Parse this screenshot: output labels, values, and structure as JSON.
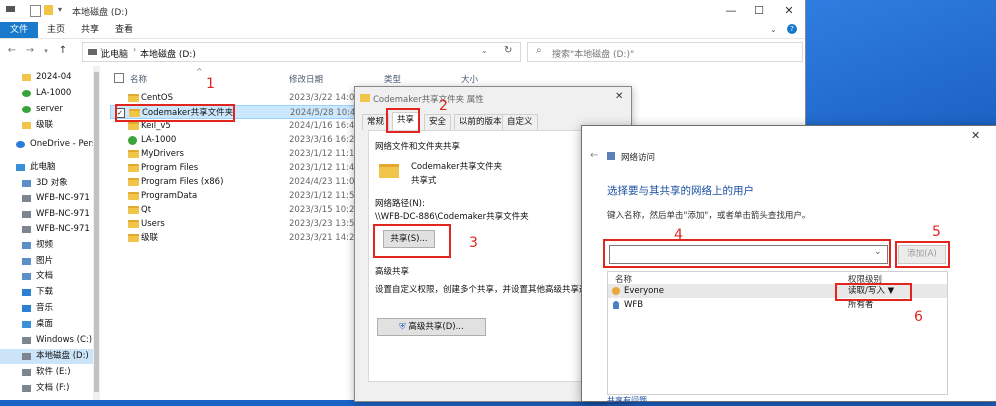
{
  "window": {
    "title": "本地磁盘 (D:)",
    "min": "—",
    "max": "☐",
    "close": "✕",
    "help": "?"
  },
  "ribbon": {
    "tabs": [
      "文件",
      "主页",
      "共享",
      "查看"
    ]
  },
  "address": {
    "path": [
      "此电脑",
      "本地磁盘 (D:)"
    ],
    "search_placeholder": "搜索\"本地磁盘 (D:)\""
  },
  "nav": {
    "items": [
      {
        "label": "2024-04",
        "icon": "folder-icon"
      },
      {
        "label": "LA-1000",
        "icon": "folder-check-icon"
      },
      {
        "label": "server",
        "icon": "folder-check-icon"
      },
      {
        "label": "级联",
        "icon": "folder-icon"
      },
      {
        "label": "OneDrive - Perso",
        "icon": "cloud-icon"
      },
      {
        "label": "此电脑",
        "icon": "computer-icon"
      },
      {
        "label": "3D 对象",
        "icon": "3d-objects-icon"
      },
      {
        "label": "WFB-NC-971 上",
        "icon": "network-drive-icon"
      },
      {
        "label": "WFB-NC-971 上",
        "icon": "network-drive-icon"
      },
      {
        "label": "WFB-NC-971 上",
        "icon": "network-drive-icon"
      },
      {
        "label": "视频",
        "icon": "video-icon"
      },
      {
        "label": "图片",
        "icon": "pictures-icon"
      },
      {
        "label": "文档",
        "icon": "documents-icon"
      },
      {
        "label": "下载",
        "icon": "download-icon"
      },
      {
        "label": "音乐",
        "icon": "music-icon"
      },
      {
        "label": "桌面",
        "icon": "desktop-icon"
      },
      {
        "label": "Windows (C:)",
        "icon": "drive-icon"
      },
      {
        "label": "本地磁盘 (D:)",
        "icon": "drive-icon",
        "selected": true
      },
      {
        "label": "软件 (E:)",
        "icon": "drive-icon"
      },
      {
        "label": "文档 (F:)",
        "icon": "drive-icon"
      }
    ]
  },
  "files": {
    "headers": {
      "name": "名称",
      "date": "修改日期",
      "type": "类型",
      "size": "大小"
    },
    "rows": [
      {
        "name": "CentOS",
        "date": "2023/3/22 14:00",
        "icon": "folder-icon"
      },
      {
        "name": "Codemaker共享文件夹",
        "date": "2024/5/28 10:40",
        "icon": "folder-icon",
        "selected": true
      },
      {
        "name": "Keil_v5",
        "date": "2024/1/16 16:49",
        "icon": "folder-icon"
      },
      {
        "name": "LA-1000",
        "date": "2023/3/16 16:29",
        "icon": "folder-check-icon"
      },
      {
        "name": "MyDrivers",
        "date": "2023/1/12 11:14",
        "icon": "folder-icon"
      },
      {
        "name": "Program Files",
        "date": "2023/1/12 11:42",
        "icon": "folder-icon"
      },
      {
        "name": "Program Files (x86)",
        "date": "2024/4/23 11:03",
        "icon": "folder-icon"
      },
      {
        "name": "ProgramData",
        "date": "2023/1/12 11:59",
        "icon": "folder-icon"
      },
      {
        "name": "Qt",
        "date": "2023/3/15 10:22",
        "icon": "folder-icon"
      },
      {
        "name": "Users",
        "date": "2023/3/23 13:52",
        "icon": "folder-icon"
      },
      {
        "name": "级联",
        "date": "2023/3/21 14:27",
        "icon": "folder-icon"
      }
    ]
  },
  "props": {
    "title": "Codemaker共享文件夹 属性",
    "tabs": [
      "常规",
      "共享",
      "安全",
      "以前的版本",
      "自定义"
    ],
    "section_net": "网络文件和文件夹共享",
    "folder_name": "Codemaker共享文件夹",
    "folder_state": "共享式",
    "net_path_label": "网络路径(N):",
    "net_path": "\\\\WFB-DC-886\\Codemaker共享文件夹",
    "share_btn": "共享(S)...",
    "adv_section": "高级共享",
    "adv_desc": "设置自定义权限，创建多个共享，并设置其他高级共享选项",
    "adv_btn": "高级共享(D)..."
  },
  "net": {
    "title": "网络访问",
    "heading": "选择要与其共享的网络上的用户",
    "sub": "键入名称，然后单击\"添加\"，或者单击箭头查找用户。",
    "input_value": "",
    "add_btn": "添加(A)",
    "col_name": "名称",
    "col_perm": "权限级别",
    "rows": [
      {
        "name": "Everyone",
        "perm": "读取/写入 ▼",
        "selected": true
      },
      {
        "name": "WFB",
        "perm": "所有者"
      }
    ],
    "footer_link": "共享有问题"
  },
  "annotations": [
    "1",
    "2",
    "3",
    "4",
    "5",
    "6"
  ],
  "colors": {
    "accent": "#1979ca",
    "annotation_red": "#e0261f",
    "heading_blue": "#1d4fa3"
  }
}
